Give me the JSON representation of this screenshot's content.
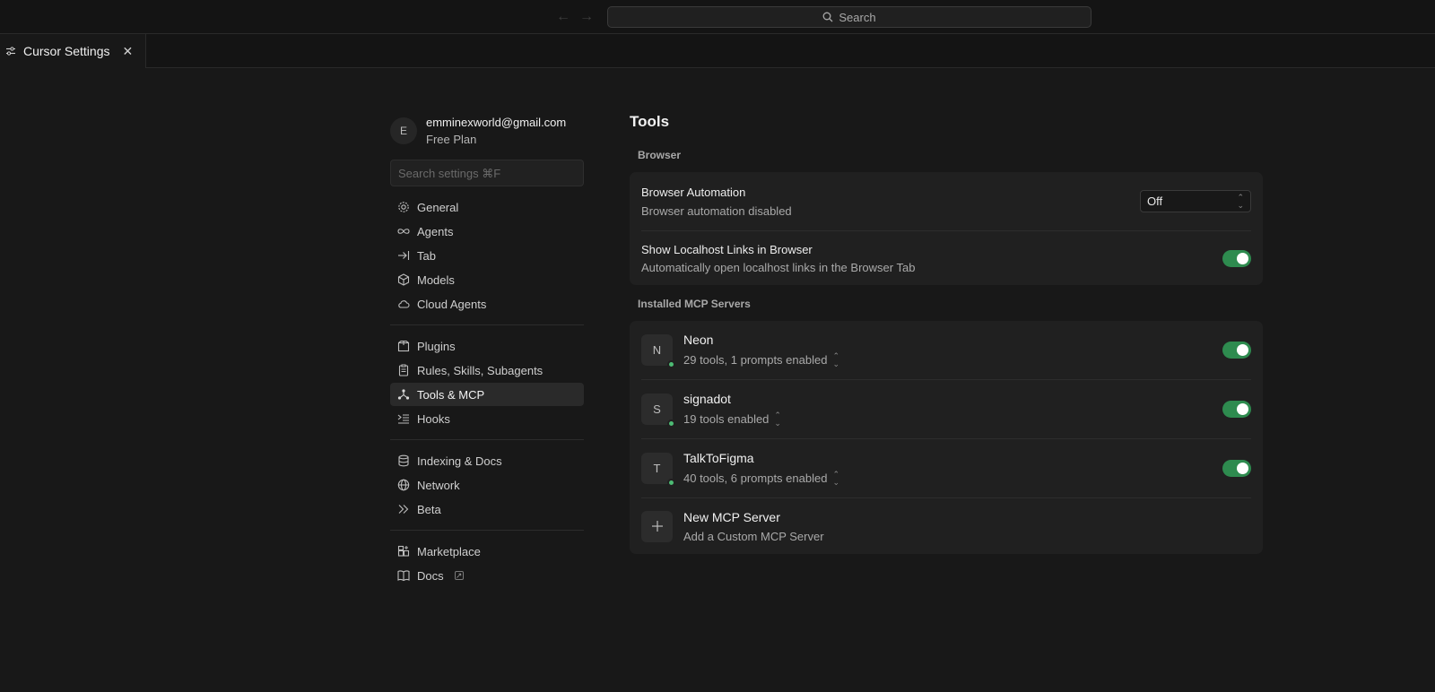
{
  "titlebar": {
    "search_label": "Search"
  },
  "tab": {
    "label": "Cursor Settings"
  },
  "account": {
    "initial": "E",
    "email": "emminexworld@gmail.com",
    "plan": "Free Plan"
  },
  "sidebar": {
    "search_placeholder": "Search settings ⌘F",
    "groups": [
      [
        {
          "label": "General",
          "icon": "gear-icon"
        },
        {
          "label": "Agents",
          "icon": "infinity-icon"
        },
        {
          "label": "Tab",
          "icon": "tab-arrow-icon"
        },
        {
          "label": "Models",
          "icon": "cube-icon"
        },
        {
          "label": "Cloud Agents",
          "icon": "cloud-icon"
        }
      ],
      [
        {
          "label": "Plugins",
          "icon": "box-icon"
        },
        {
          "label": "Rules, Skills, Subagents",
          "icon": "clipboard-icon"
        },
        {
          "label": "Tools & MCP",
          "icon": "network-icon",
          "active": true
        },
        {
          "label": "Hooks",
          "icon": "hooks-icon"
        }
      ],
      [
        {
          "label": "Indexing & Docs",
          "icon": "database-icon"
        },
        {
          "label": "Network",
          "icon": "globe-icon"
        },
        {
          "label": "Beta",
          "icon": "double-chevron-icon"
        }
      ],
      [
        {
          "label": "Marketplace",
          "icon": "grid-plus-icon"
        },
        {
          "label": "Docs",
          "icon": "book-icon",
          "external": true
        }
      ]
    ]
  },
  "main": {
    "title": "Tools",
    "browser_section": "Browser",
    "browser_automation": {
      "title": "Browser Automation",
      "subtitle": "Browser automation disabled",
      "value": "Off"
    },
    "localhost_links": {
      "title": "Show Localhost Links in Browser",
      "subtitle": "Automatically open localhost links in the Browser Tab",
      "enabled": true
    },
    "mcp_section": "Installed MCP Servers",
    "servers": [
      {
        "initial": "N",
        "name": "Neon",
        "summary": "29 tools, 1 prompts enabled",
        "enabled": true
      },
      {
        "initial": "S",
        "name": "signadot",
        "summary": "19 tools enabled",
        "enabled": true
      },
      {
        "initial": "T",
        "name": "TalkToFigma",
        "summary": "40 tools, 6 prompts enabled",
        "enabled": true
      }
    ],
    "new_server": {
      "title": "New MCP Server",
      "subtitle": "Add a Custom MCP Server"
    }
  },
  "colors": {
    "background": "#181818",
    "card": "#202020",
    "toggle_on": "#2e8b4f",
    "status_dot": "#4dbb74"
  }
}
